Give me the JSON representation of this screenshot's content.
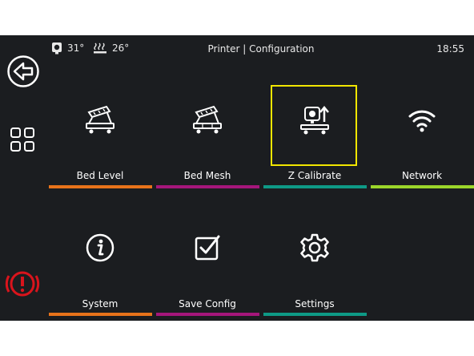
{
  "status": {
    "extruder_temp": "31°",
    "bed_temp": "26°",
    "title": "Printer | Configuration",
    "time": "18:55"
  },
  "nav": {
    "back": "back-arrow-icon",
    "menu": "grid-icon",
    "stop": "emergency-stop-icon"
  },
  "tiles": [
    {
      "label": "Bed Level",
      "icon": "bed-level-icon",
      "bar": "#e8731a"
    },
    {
      "label": "Bed Mesh",
      "icon": "bed-mesh-icon",
      "bar": "#a5167b"
    },
    {
      "label": "Z Calibrate",
      "icon": "z-calibrate-icon",
      "bar": "#0e9a86"
    },
    {
      "label": "Network",
      "icon": "wifi-icon",
      "bar": "#9bd62a"
    },
    {
      "label": "System",
      "icon": "info-icon",
      "bar": "#e8731a"
    },
    {
      "label": "Save Config",
      "icon": "save-check-icon",
      "bar": "#a5167b"
    },
    {
      "label": "Settings",
      "icon": "gear-icon",
      "bar": "#0e9a86"
    }
  ],
  "colors": {
    "background": "#1b1d20",
    "selection": "#f2e600",
    "stop": "#d9141c"
  }
}
